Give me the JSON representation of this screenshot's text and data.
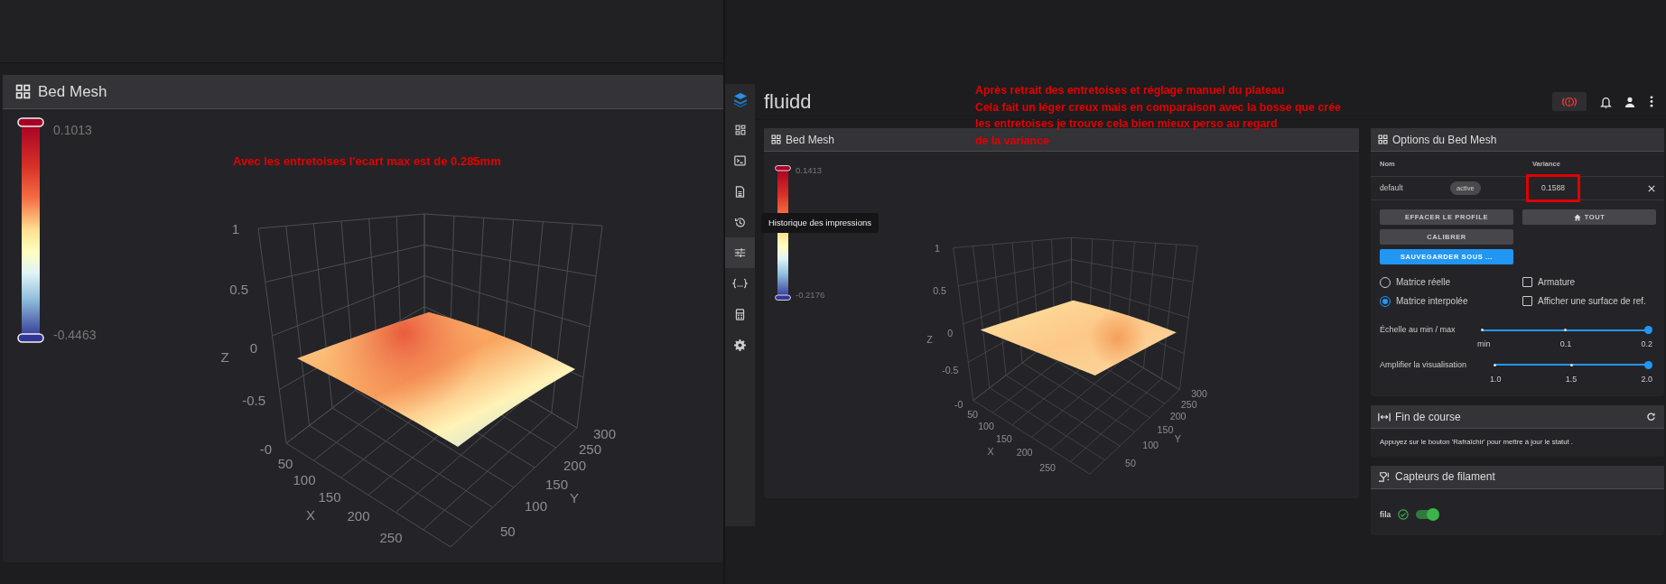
{
  "left_panel": {
    "title": "Bed Mesh",
    "annotation": "Avec les entretoises l'ecart max est de 0.285mm",
    "legend": {
      "max": "0.1013",
      "min": "-0.4463"
    },
    "plot": {
      "z_ticks": [
        "1",
        "0.5",
        "0",
        "-0.5",
        "-0"
      ],
      "z_label": "Z",
      "x_ticks": [
        "50",
        "100",
        "150",
        "200",
        "250"
      ],
      "x_label": "X",
      "y_ticks": [
        "300",
        "250",
        "200",
        "150",
        "100",
        "50"
      ],
      "y_label": "Y"
    }
  },
  "app": {
    "brand": "fluidd",
    "annotation": "Après retrait des entretoises et réglage manuel du plateau\nCela fait un léger creux mais en comparaison avec la bosse que crée\nles entretoises je trouve cela bien mieux perso au regard\nde la variance",
    "sidebar": [
      {
        "kind": "dashboard",
        "selected": false
      },
      {
        "kind": "console",
        "selected": false
      },
      {
        "kind": "files",
        "selected": false
      },
      {
        "kind": "history",
        "selected": false,
        "tooltip": "Historique des impressions"
      },
      {
        "kind": "tune",
        "selected": true
      },
      {
        "kind": "macros",
        "selected": false
      },
      {
        "kind": "device",
        "selected": false
      },
      {
        "kind": "settings",
        "selected": false
      }
    ],
    "bed_mesh_card": {
      "title": "Bed Mesh",
      "legend": {
        "max": "0.1413",
        "min": "-0.2176"
      },
      "plot": {
        "z_ticks": [
          "1",
          "0.5",
          "0",
          "-0.5",
          "-0"
        ],
        "z_label": "Z",
        "x_ticks": [
          "50",
          "100",
          "150",
          "200",
          "250"
        ],
        "x_label": "X",
        "y_ticks": [
          "300",
          "250",
          "200",
          "150",
          "100",
          "50"
        ],
        "y_label": "Y"
      }
    },
    "options_panel": {
      "title": "Options du Bed Mesh",
      "columns": [
        "Nom",
        "Variance"
      ],
      "profiles": [
        {
          "name": "default",
          "badge": "active",
          "variance": "0.1588",
          "highlighted": true
        }
      ],
      "buttons": [
        {
          "label": "EFFACER LE PROFILE",
          "kind": "plain"
        },
        {
          "label": "TOUT",
          "kind": "home"
        },
        {
          "label": "CALIBRER",
          "kind": "plain"
        },
        {
          "label": "SAUVEGARDER SOUS ...",
          "kind": "primary"
        }
      ],
      "radios": [
        {
          "label": "Matrice réelle",
          "selected": false
        },
        {
          "label": "Matrice interpolée",
          "selected": true
        }
      ],
      "checkboxes": [
        {
          "label": "Armature",
          "checked": false
        },
        {
          "label": "Afficher une surface de ref.",
          "checked": false
        }
      ],
      "sliders": [
        {
          "label": "Échelle au min / max",
          "level": 1,
          "ticks": [
            "min",
            "0.1",
            "0.2"
          ]
        },
        {
          "label": "Amplifier la visualisation",
          "level": 1,
          "ticks": [
            "1.0",
            "1.5",
            "2.0"
          ]
        }
      ]
    },
    "endstops_panel": {
      "title": "Fin de course",
      "message": "Appuyez sur le bouton 'Rafraîchir' pour mettre à jour le statut ."
    },
    "filament_panel": {
      "title": "Capteurs de filament",
      "sensors": [
        {
          "name": "fila",
          "detected": true,
          "on": true
        }
      ]
    }
  }
}
